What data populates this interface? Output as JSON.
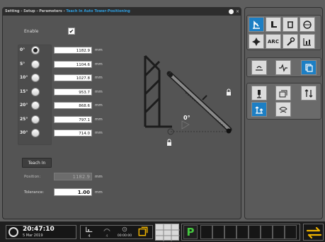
{
  "dialog": {
    "title": "Setting - Setup - Parameters - ",
    "title_accent": "Teach In Auto Tower-Positioning",
    "close_glyph": "×",
    "enable_label": "Enable",
    "enable_checked": true,
    "angles": [
      {
        "label": "0°",
        "value": "1182.9",
        "unit": "mm",
        "selected": true
      },
      {
        "label": "5°",
        "value": "1104.6",
        "unit": "mm",
        "selected": false
      },
      {
        "label": "10°",
        "value": "1027.8",
        "unit": "mm",
        "selected": false
      },
      {
        "label": "15°",
        "value": "953.7",
        "unit": "mm",
        "selected": false
      },
      {
        "label": "20°",
        "value": "868.6",
        "unit": "mm",
        "selected": false
      },
      {
        "label": "25°",
        "value": "797.1",
        "unit": "mm",
        "selected": false
      },
      {
        "label": "30°",
        "value": "714.0",
        "unit": "mm",
        "selected": false
      }
    ],
    "teach_in_label": "Teach In",
    "position_label": "Position:",
    "position_value": "1182.9",
    "position_unit": "mm",
    "tolerance_label": "Tolerance:",
    "tolerance_value": "1.00",
    "tolerance_unit": "mm",
    "diagram_angle_label": "0°"
  },
  "palette": {
    "group1": [
      {
        "icon": "tower-position-icon",
        "active": true
      },
      {
        "icon": "tower-icon",
        "active": false
      },
      {
        "icon": "cup-icon",
        "active": false
      },
      {
        "icon": "ball-icon",
        "active": false
      },
      {
        "icon": "crosshair-icon",
        "active": false
      },
      {
        "icon": "arc-icon",
        "label": "ARC",
        "active": false
      },
      {
        "icon": "wrench-icon",
        "active": false
      },
      {
        "icon": "bar-chart-icon",
        "active": false
      }
    ],
    "group2": [
      {
        "icon": "wave-sensor-icon",
        "active": false
      },
      {
        "icon": "pulse-icon",
        "active": false
      },
      {
        "icon": "copy-icon",
        "active": true
      }
    ],
    "group3": [
      {
        "icon": "torch-icon",
        "active": false
      },
      {
        "icon": "layers-icon",
        "active": false
      },
      {
        "icon": "swap-height-icon",
        "active": false
      },
      {
        "icon": "teach-in-icon",
        "active": true
      },
      {
        "icon": "eye-scan-icon",
        "active": false
      }
    ]
  },
  "statusbar": {
    "time": "20:47:10",
    "date": "5 Mar 2019",
    "tool_counter_1": "4",
    "tool_counter_2": "4",
    "timer": "00:00:00",
    "mode_letter": "P",
    "colors": {
      "mode_green": "#46c840",
      "accent_blue": "#1d7fc4",
      "arrow_yellow": "#f0b400"
    }
  }
}
